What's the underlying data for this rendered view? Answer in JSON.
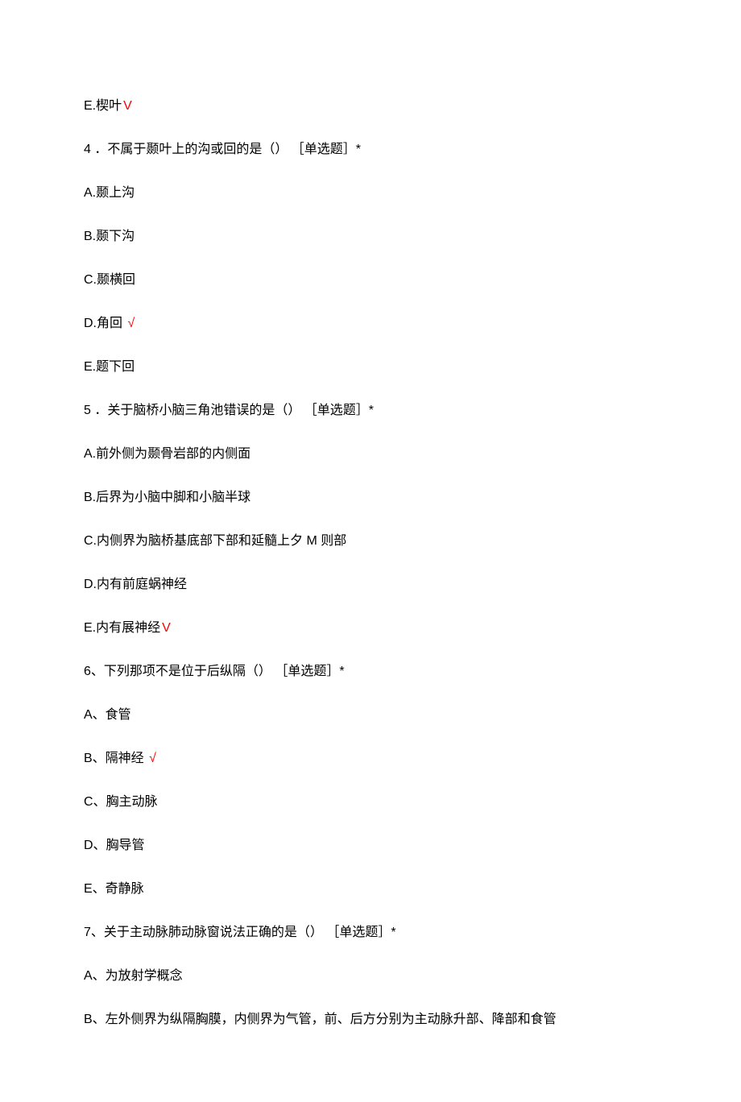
{
  "lines": [
    {
      "text": "E.楔叶",
      "correct_marker": "V"
    },
    {
      "text": "4 ．不属于颞叶上的沟或回的是（） ［单选题］*"
    },
    {
      "text": "A.颞上沟"
    },
    {
      "text": "B.颞下沟"
    },
    {
      "text": "C.颞横回"
    },
    {
      "text": "D.角回",
      "correct_marker": " √"
    },
    {
      "text": "E.题下回"
    },
    {
      "text": "5 ．关于脑桥小脑三角池错误的是（） ［单选题］*"
    },
    {
      "text": "A.前外侧为颞骨岩部的内侧面"
    },
    {
      "text": "B.后界为小脑中脚和小脑半球"
    },
    {
      "text": "C.内侧界为脑桥基底部下部和延髓上夕 M 则部"
    },
    {
      "text": "D.内有前庭蜗神经"
    },
    {
      "text": "E.内有展神经",
      "correct_marker": "V"
    },
    {
      "text": "6、下列那项不是位于后纵隔（） ［单选题］*"
    },
    {
      "text": "A、食管"
    },
    {
      "text": "B、隔神经",
      "correct_marker": " √"
    },
    {
      "text": "C、胸主动脉"
    },
    {
      "text": "D、胸导管"
    },
    {
      "text": "E、奇静脉"
    },
    {
      "text": "7、关于主动脉肺动脉窗说法正确的是（） ［单选题］*"
    },
    {
      "text": "A、为放射学概念"
    },
    {
      "text": "B、左外侧界为纵隔胸膜，内侧界为气管，前、后方分别为主动脉升部、降部和食管"
    }
  ]
}
